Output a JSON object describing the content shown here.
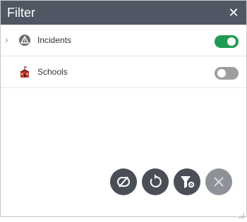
{
  "header": {
    "title": "Filter",
    "close_icon": "close-icon"
  },
  "layers": [
    {
      "label": "Incidents",
      "icon": "warning-triangle-icon",
      "expandable": true,
      "enabled": true
    },
    {
      "label": "Schools",
      "icon": "schoolhouse-icon",
      "expandable": false,
      "enabled": false
    }
  ],
  "actions": [
    {
      "icon": "toggle-all-icon"
    },
    {
      "icon": "reset-icon"
    },
    {
      "icon": "filter-settings-icon"
    },
    {
      "icon": "close-icon",
      "disabled": true
    }
  ],
  "colors": {
    "header": "#4f5764",
    "toggle_on": "#219b53",
    "toggle_off": "#9e9e9e",
    "action_button": "#4a4f57",
    "action_button_disabled": "#8e9298"
  }
}
